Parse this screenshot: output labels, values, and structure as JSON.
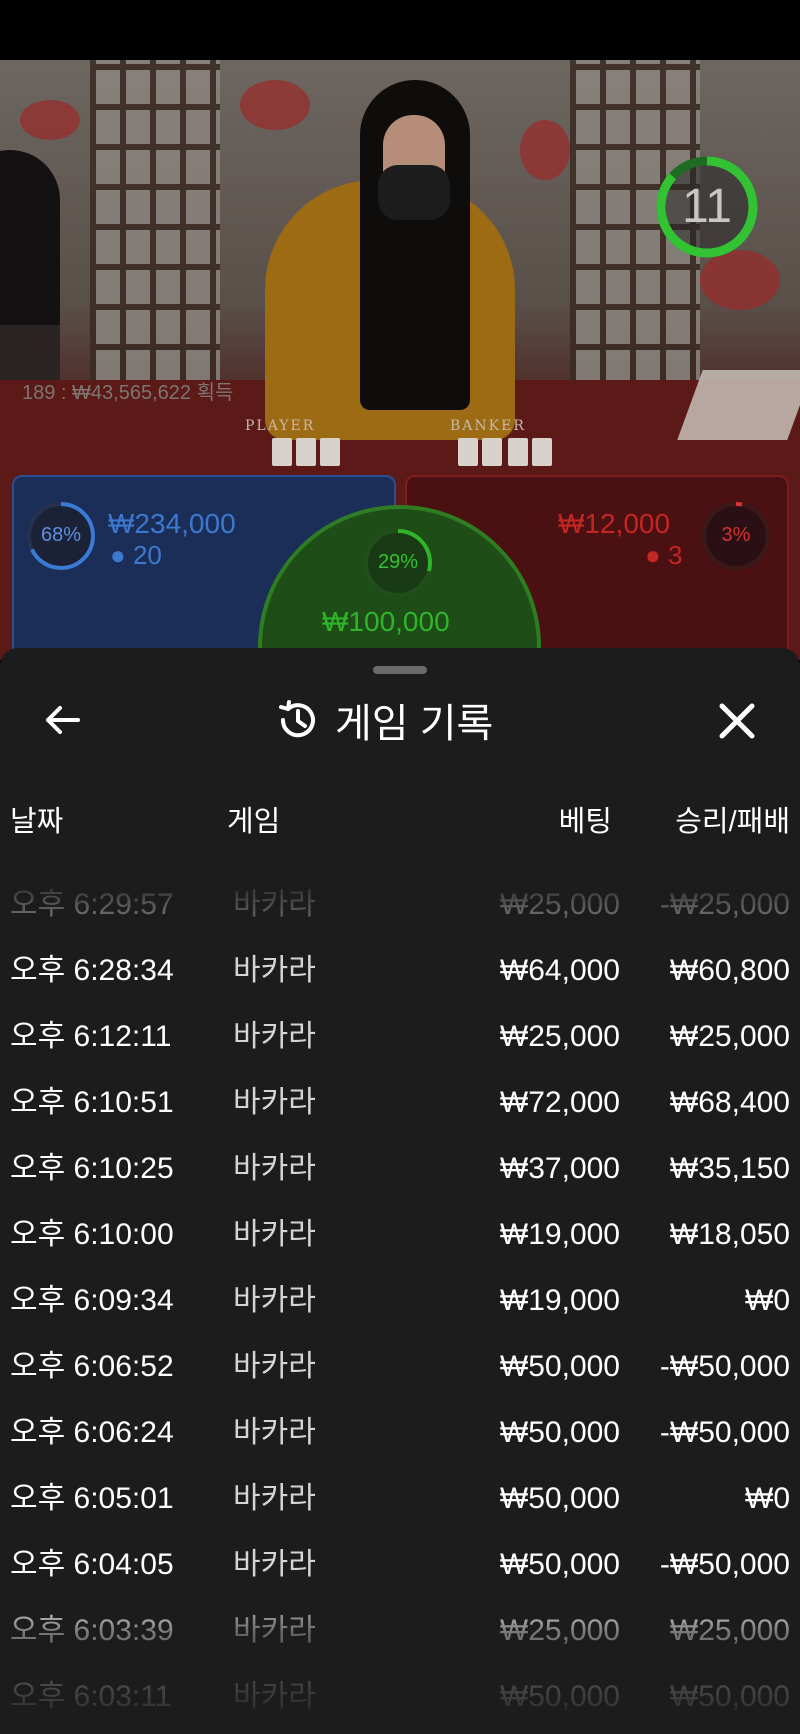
{
  "video": {
    "timer": "11",
    "table_stat": "189 : ₩43,565,622 획득",
    "felt_player": "PLAYER",
    "felt_banker": "BANKER",
    "player": {
      "pct": "68%",
      "amount": "₩234,000",
      "players": "20",
      "pct_value": 68,
      "color": "#3a7bd5"
    },
    "banker": {
      "pct": "3%",
      "amount": "₩12,000",
      "players": "3",
      "pct_value": 3,
      "color": "#d8322e"
    },
    "tie": {
      "pct": "29%",
      "amount": "₩100,000",
      "pct_value": 29,
      "color": "#2fb52a"
    }
  },
  "sheet": {
    "title": "게임 기록",
    "back_icon": "arrow-left-icon",
    "history_icon": "history-icon",
    "close_icon": "close-icon",
    "columns": {
      "date": "날짜",
      "game": "게임",
      "bet": "베팅",
      "winloss": "승리/패배"
    },
    "rows": [
      {
        "time": "오후 6:29:57",
        "game": "바카라",
        "bet": "₩25,000",
        "result": "-₩25,000"
      },
      {
        "time": "오후 6:28:34",
        "game": "바카라",
        "bet": "₩64,000",
        "result": "₩60,800"
      },
      {
        "time": "오후 6:12:11",
        "game": "바카라",
        "bet": "₩25,000",
        "result": "₩25,000"
      },
      {
        "time": "오후 6:10:51",
        "game": "바카라",
        "bet": "₩72,000",
        "result": "₩68,400"
      },
      {
        "time": "오후 6:10:25",
        "game": "바카라",
        "bet": "₩37,000",
        "result": "₩35,150"
      },
      {
        "time": "오후 6:10:00",
        "game": "바카라",
        "bet": "₩19,000",
        "result": "₩18,050"
      },
      {
        "time": "오후 6:09:34",
        "game": "바카라",
        "bet": "₩19,000",
        "result": "₩0"
      },
      {
        "time": "오후 6:06:52",
        "game": "바카라",
        "bet": "₩50,000",
        "result": "-₩50,000"
      },
      {
        "time": "오후 6:06:24",
        "game": "바카라",
        "bet": "₩50,000",
        "result": "-₩50,000"
      },
      {
        "time": "오후 6:05:01",
        "game": "바카라",
        "bet": "₩50,000",
        "result": "₩0"
      },
      {
        "time": "오후 6:04:05",
        "game": "바카라",
        "bet": "₩50,000",
        "result": "-₩50,000"
      },
      {
        "time": "오후 6:03:39",
        "game": "바카라",
        "bet": "₩25,000",
        "result": "₩25,000"
      },
      {
        "time": "오후 6:03:11",
        "game": "바카라",
        "bet": "₩50,000",
        "result": "₩50,000"
      }
    ]
  }
}
